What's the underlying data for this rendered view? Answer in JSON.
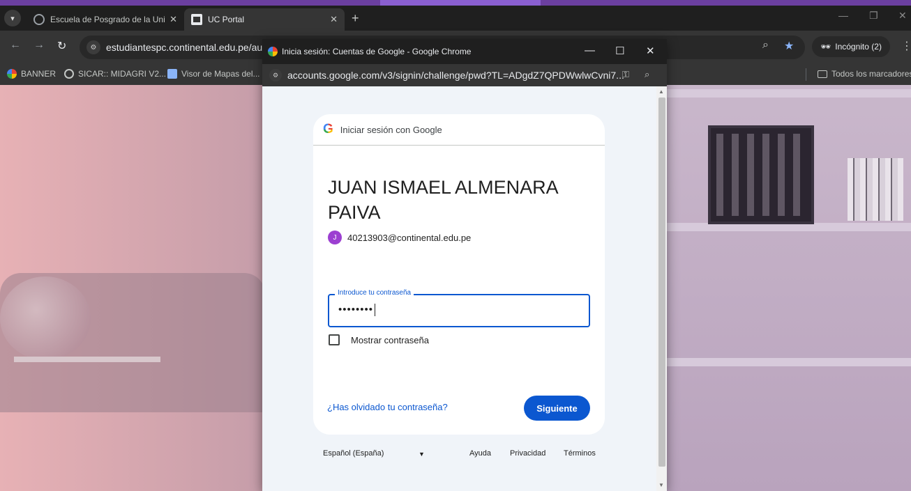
{
  "browser": {
    "tabs": [
      {
        "label": "Escuela de Posgrado de la Univ"
      },
      {
        "label": "UC Portal"
      }
    ],
    "address": "estudiantespc.continental.edu.pe/auth",
    "incognito_label": "Incógnito (2)",
    "bookmarks": [
      {
        "label": "BANNER"
      },
      {
        "label": "SICAR:: MIDAGRI V2..."
      },
      {
        "label": "Visor de Mapas del..."
      }
    ],
    "all_bookmarks_label": "Todos los marcadores"
  },
  "popup": {
    "title": "Inicia sesión: Cuentas de Google - Google Chrome",
    "url": "accounts.google.com/v3/signin/challenge/pwd?TL=ADgdZ7QPDWwlwCvni7..."
  },
  "signin": {
    "header_logo": "G",
    "header_text": "Iniciar sesión con Google",
    "user_name": "JUAN ISMAEL ALMENARA PAIVA",
    "avatar_initial": "J",
    "email": "40213903@continental.edu.pe",
    "password_label": "Introduce tu contraseña",
    "password_value": "••••••••",
    "show_password_label": "Mostrar contraseña",
    "forgot_label": "¿Has olvidado tu contraseña?",
    "next_label": "Siguiente"
  },
  "footer": {
    "language": "Español (España)",
    "help": "Ayuda",
    "privacy": "Privacidad",
    "terms": "Términos"
  },
  "colors": {
    "accent": "#0b57d0",
    "avatar": "#9c3fd1",
    "incognito_bar": "#6b3fa0"
  }
}
